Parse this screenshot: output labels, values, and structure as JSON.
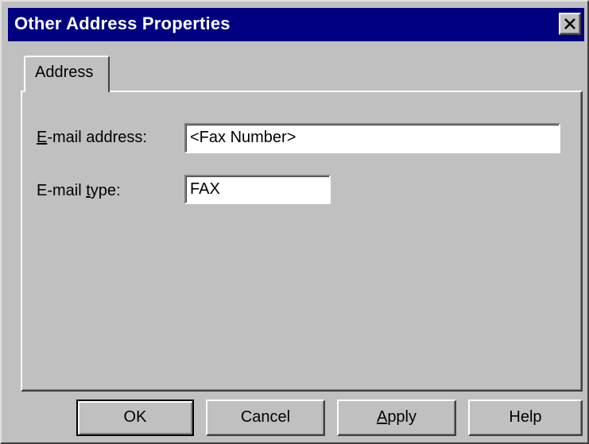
{
  "window": {
    "title": "Other Address Properties"
  },
  "tabs": [
    {
      "label": "Address",
      "selected": true
    }
  ],
  "form": {
    "email_address": {
      "label_mnemonic": "E",
      "label_rest": "-mail address:",
      "value": "<Fax Number>"
    },
    "email_type": {
      "label_before": "E-mail ",
      "label_mnemonic": "t",
      "label_after": "ype:",
      "value": "FAX"
    }
  },
  "buttons": {
    "ok": "OK",
    "cancel": "Cancel",
    "apply_mnemonic": "A",
    "apply_rest": "pply",
    "help": "Help"
  },
  "icons": {
    "close": "close-icon"
  }
}
